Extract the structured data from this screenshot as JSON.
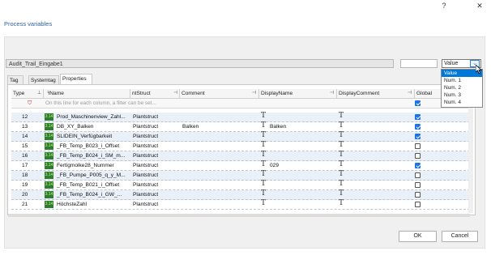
{
  "window": {
    "help": "?",
    "close": "✕"
  },
  "heading": "Process variables",
  "name_field": "Audit_Trail_Eingabe1",
  "combo": {
    "value": "Value",
    "options": [
      "Value",
      "Num. 1",
      "Num. 2",
      "Num. 3",
      "Num. 4"
    ],
    "selected": 0
  },
  "tabs": [
    "Tag",
    "Systemtag",
    "Properties"
  ],
  "active_tab": 2,
  "columns": {
    "type": "Type",
    "name": "Name",
    "struct": "ntStruct",
    "comment": "Comment",
    "display": "DisplayName",
    "dcomment": "DisplayComment",
    "global": "Global"
  },
  "filter_text": "On this line for each column, a filter can be set...",
  "type_badge": "3.14",
  "text_glyph": "T",
  "rows": [
    {
      "num": "12",
      "name": "Prod_Maschinenview_Zahl...",
      "struct": "Plantstruct",
      "comment": "",
      "display": "",
      "global": true
    },
    {
      "num": "13",
      "name": "DB_XY_Balken",
      "struct": "Plantstruct",
      "comment": "Balken",
      "display": "Balken",
      "global": true
    },
    {
      "num": "14",
      "name": "SLIDEIN_Verfügbarkeit",
      "struct": "Plantstruct",
      "comment": "",
      "display": "",
      "global": true
    },
    {
      "num": "15",
      "name": "_FB_Temp_B023_i_Offset",
      "struct": "Plantstruct",
      "comment": "",
      "display": "",
      "global": false
    },
    {
      "num": "16",
      "name": "_FB_Temp_B024_i_SM_m...",
      "struct": "Plantstruct",
      "comment": "",
      "display": "",
      "global": false
    },
    {
      "num": "17",
      "name": "Fertigmolke28_Nummer",
      "struct": "Plantstruct",
      "comment": "",
      "display": "029",
      "global": true
    },
    {
      "num": "18",
      "name": "_FB_Pumpe_P005_q_y_M...",
      "struct": "Plantstruct",
      "comment": "",
      "display": "",
      "global": false
    },
    {
      "num": "19",
      "name": "_FB_Temp_B021_i_Offset",
      "struct": "Plantstruct",
      "comment": "",
      "display": "",
      "global": false
    },
    {
      "num": "20",
      "name": "_FB_Temp_B024_i_GW_...",
      "struct": "Plantstruct",
      "comment": "",
      "display": "",
      "global": false
    },
    {
      "num": "21",
      "name": "HöchsteZahl",
      "struct": "Plantstruct",
      "comment": "",
      "display": "",
      "global": false
    }
  ],
  "buttons": {
    "ok": "OK",
    "cancel": "Cancel"
  },
  "colors": {
    "accent": "#0078d7",
    "row_alt": "#eaf0f7",
    "heading": "#2c5fa8",
    "type_badge": "#2e7d32"
  }
}
